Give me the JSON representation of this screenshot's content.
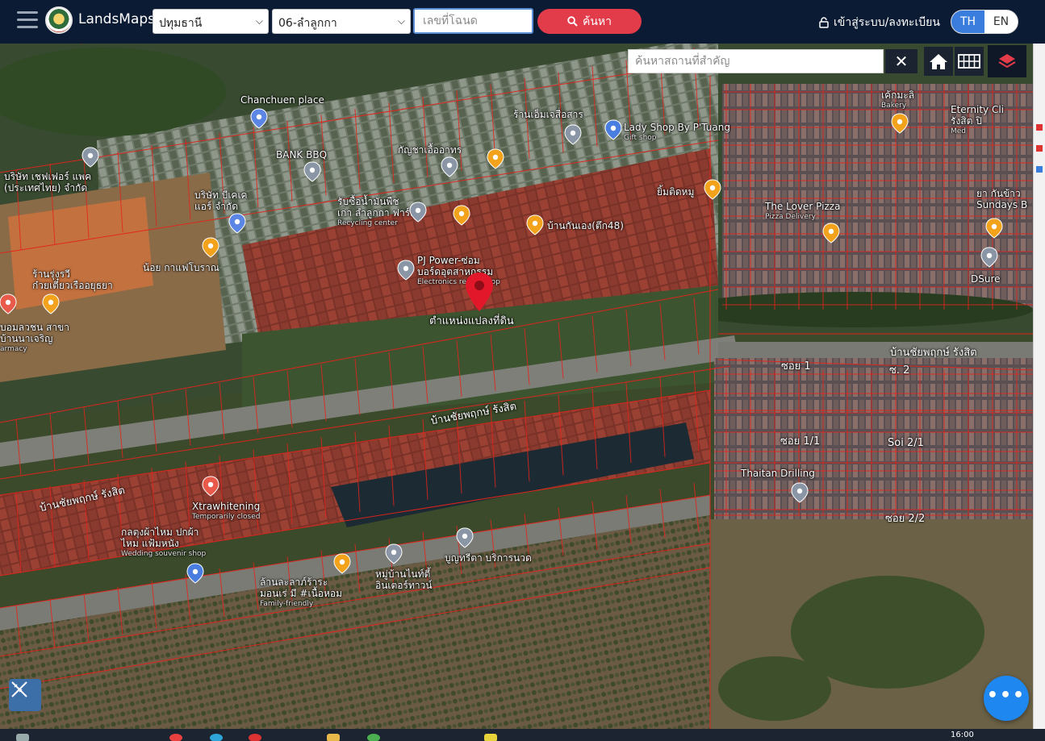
{
  "header": {
    "brand": "LandsMaps",
    "province_select": "ปทุมธานี",
    "district_select": "06-ลำลูกกา",
    "deed_placeholder": "เลขที่โฉนด",
    "search_label": "ค้นหา",
    "login_label": "เข้าสู่ระบบ/ลงทะเบียน",
    "lang_th": "TH",
    "lang_en": "EN"
  },
  "map": {
    "place_search_placeholder": "ค้นหาสถานที่สำคัญ",
    "close_symbol": "✕",
    "fab_symbol": "•••",
    "parcel_marker_label": "ตำแหน่งแปลงที่ดิน",
    "places": [
      {
        "name": "Chanchuen place"
      },
      {
        "name": "ร้านเอ็มเจสื่อสาร"
      },
      {
        "name": "Lady Shop By P'Tuang",
        "sub": "Gift shop"
      },
      {
        "name": "BANK BBQ"
      },
      {
        "name": "กัญชาเอื้ออาทร"
      },
      {
        "name": "บริษัท เชฟเฟอร์ แพค",
        "line2": "(ประเทศไทย) จำกัด"
      },
      {
        "name": "บริษัท บีเคเค",
        "line2": "แอร์ จำกัด"
      },
      {
        "name": "รับซื้อน้ำมันพืช",
        "line2": "เก่า ลำลูกกา ฟาร์ม",
        "sub": "Recycling center"
      },
      {
        "name": "ยิ้มติดหมู"
      },
      {
        "name": "บ้านกันเอง(ตึก48)"
      },
      {
        "name": "น้อย กาแฟโบราณ"
      },
      {
        "name": "PJ Power-ซ่อม",
        "line2": "บอร์ดอุตสาหกรรม",
        "sub": "Electronics repair shop"
      },
      {
        "name": "ร้านรุ่งรวี",
        "line2": "ก๋วยเตี๋ยวเรืออยุธยา"
      },
      {
        "name": "บอมลวชน สาขา",
        "line2": "บ้านนาเจริญ",
        "sub": "armacy"
      },
      {
        "name": "เค้กมะลิ",
        "sub": "Bakery"
      },
      {
        "name": "Eternity Cli",
        "line2": "รังสิต ปิ",
        "sub": "Med"
      },
      {
        "name": "The Lover Pizza",
        "sub": "Pizza Delivery"
      },
      {
        "name": "ยา กันข้าว",
        "line2": "Sundays B"
      },
      {
        "name": "DSure"
      },
      {
        "name": "Xtrawhitening",
        "sub": "Temporarily closed"
      },
      {
        "name": "กลตุงผ้าไหม ปกผ้า",
        "line2": "ไหม แฟ้มหนัง",
        "sub": "Wedding souvenir shop"
      },
      {
        "name": "บูญทรีตา บริการนวด"
      },
      {
        "name": "หมู่บ้านไนท์ตี้",
        "line2": "อินเตอร์ทาวน์"
      },
      {
        "name": "ล้านละลาภ์ร้าระ",
        "line2": "มอนเร่ มี #เนื้อหอม",
        "sub": "Family-friendly"
      },
      {
        "name": "Thaitan Drilling"
      }
    ],
    "roads": [
      {
        "name": "บ้านชัยพฤกษ์ รังสิต"
      },
      {
        "name": "บ้านชัยพฤกษ์ รังสิต"
      },
      {
        "name": "บ้านชัยพฤกษ์ รังสิต"
      },
      {
        "name": "ซอย 1"
      },
      {
        "name": "ซ. 2"
      },
      {
        "name": "ซอย 1/1"
      },
      {
        "name": "Soi 2/1"
      },
      {
        "name": "ซอย 2/2"
      }
    ]
  },
  "taskbar": {
    "clock": "16:00"
  }
}
